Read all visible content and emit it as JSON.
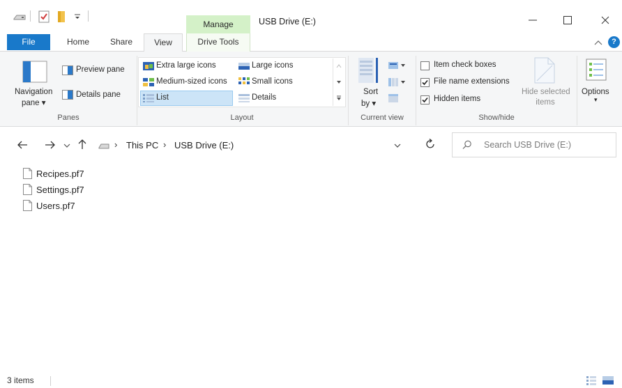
{
  "window": {
    "title": "USB Drive (E:)",
    "context_tab_group": "Manage"
  },
  "tabs": {
    "file": "File",
    "home": "Home",
    "share": "Share",
    "view": "View",
    "drive_tools": "Drive Tools"
  },
  "ribbon": {
    "panes": {
      "navigation_pane": "Navigation",
      "navigation_pane_2": "pane",
      "preview_pane": "Preview pane",
      "details_pane": "Details pane",
      "label": "Panes"
    },
    "layout": {
      "extra_large_icons": "Extra large icons",
      "large_icons": "Large icons",
      "medium_icons": "Medium-sized icons",
      "small_icons": "Small icons",
      "list": "List",
      "details": "Details",
      "label": "Layout",
      "selected": "List"
    },
    "current_view": {
      "sort_by": "Sort",
      "sort_by_2": "by",
      "label": "Current view"
    },
    "show_hide": {
      "item_check_boxes": "Item check boxes",
      "item_check_boxes_checked": false,
      "file_name_extensions": "File name extensions",
      "file_name_extensions_checked": true,
      "hidden_items": "Hidden items",
      "hidden_items_checked": true,
      "hide_selected": "Hide selected",
      "hide_selected_2": "items",
      "label": "Show/hide"
    },
    "options": "Options"
  },
  "address": {
    "crumbs": [
      "This PC",
      "USB Drive (E:)"
    ],
    "search_placeholder": "Search USB Drive (E:)"
  },
  "files": [
    {
      "name": "Recipes.pf7"
    },
    {
      "name": "Settings.pf7"
    },
    {
      "name": "Users.pf7"
    }
  ],
  "status": {
    "item_count": "3 items"
  },
  "colors": {
    "file_tab": "#1979ca",
    "manage_context": "#d4f1c8",
    "help": "#1979ca",
    "selected_layout": "#cce4f7"
  }
}
